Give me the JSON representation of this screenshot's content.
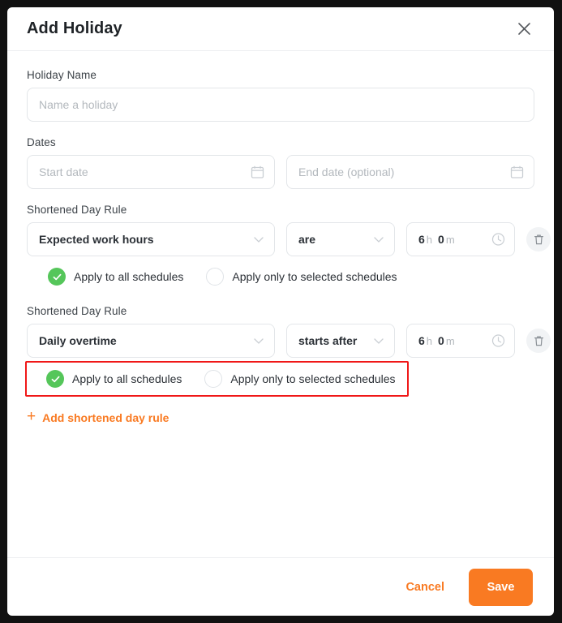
{
  "dialog": {
    "title": "Add Holiday",
    "close_icon": "close-icon"
  },
  "holiday_name": {
    "label": "Holiday Name",
    "value": "",
    "placeholder": "Name a holiday"
  },
  "dates": {
    "label": "Dates",
    "start": {
      "value": "",
      "placeholder": "Start date",
      "icon": "calendar-icon"
    },
    "end": {
      "value": "",
      "placeholder": "End date (optional)",
      "icon": "calendar-icon"
    }
  },
  "rules": [
    {
      "label": "Shortened Day Rule",
      "type": "Expected work hours",
      "condition": "are",
      "hours": "6",
      "hours_unit": "h",
      "minutes": "0",
      "minutes_unit": "m",
      "clock_icon": "clock-icon",
      "delete_icon": "trash-icon",
      "options": [
        {
          "label": "Apply to all schedules",
          "selected": true
        },
        {
          "label": "Apply only to selected schedules",
          "selected": false
        }
      ],
      "highlighted": false
    },
    {
      "label": "Shortened Day Rule",
      "type": "Daily overtime",
      "condition": "starts after",
      "hours": "6",
      "hours_unit": "h",
      "minutes": "0",
      "minutes_unit": "m",
      "clock_icon": "clock-icon",
      "delete_icon": "trash-icon",
      "options": [
        {
          "label": "Apply to all schedules",
          "selected": true
        },
        {
          "label": "Apply only to selected schedules",
          "selected": false
        }
      ],
      "highlighted": true
    }
  ],
  "add_rule": {
    "label": "Add shortened day rule",
    "plus": "+"
  },
  "footer": {
    "cancel_label": "Cancel",
    "save_label": "Save"
  },
  "colors": {
    "accent_orange": "#f97a22",
    "selected_green": "#55c65a",
    "highlight_red": "#f01818"
  }
}
